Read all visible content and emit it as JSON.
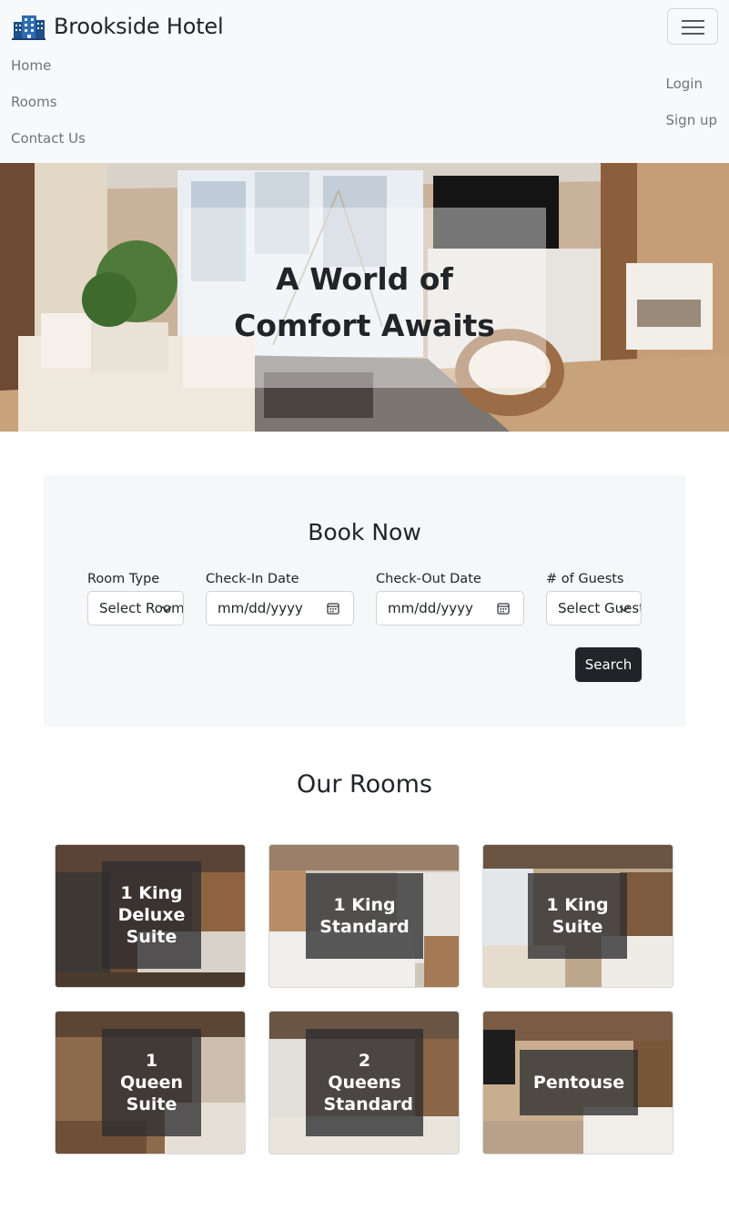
{
  "navbar": {
    "brand": "Brookside Hotel",
    "brand_icon": "hotel-building-icon",
    "links": [
      "Home",
      "Rooms",
      "Contact Us"
    ],
    "auth": [
      "Login",
      "Sign up"
    ],
    "toggler_icon": "hamburger-menu-icon"
  },
  "hero": {
    "title_line1": "A World of",
    "title_line2": "Comfort Awaits"
  },
  "booking": {
    "title": "Book Now",
    "room_type_label": "Room Type",
    "room_type_value": "Select Room",
    "checkin_label": "Check-In Date",
    "checkin_placeholder": "mm/dd/yyyy",
    "checkout_label": "Check-Out Date",
    "checkout_placeholder": "mm/dd/yyyy",
    "guests_label": "# of Guests",
    "guests_value": "Select Guests",
    "search_label": "Search"
  },
  "rooms": {
    "title": "Our Rooms",
    "items": [
      {
        "name": "1 King Deluxe Suite"
      },
      {
        "name": "1 King Standard"
      },
      {
        "name": "1 King Suite"
      },
      {
        "name": "1 Queen Suite"
      },
      {
        "name": "2 Queens Standard"
      },
      {
        "name": "Pentouse"
      }
    ]
  },
  "colors": {
    "navbar_bg": "#f8f9fa",
    "booking_bg": "#f6f7f8",
    "button_dark": "#212529",
    "nav_text": "#6c757d"
  }
}
